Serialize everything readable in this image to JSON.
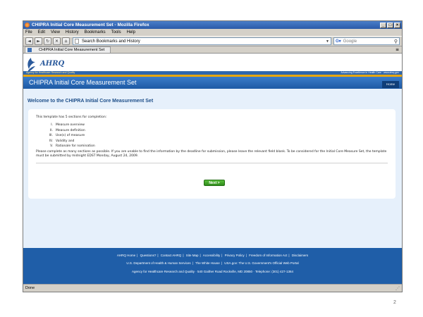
{
  "window": {
    "title": "CHIPRA Initial Core Measurement Set - Mozilla Firefox",
    "min": "_",
    "max": "□",
    "close": "×"
  },
  "menu": [
    "File",
    "Edit",
    "View",
    "History",
    "Bookmarks",
    "Tools",
    "Help"
  ],
  "nav": {
    "back": "◄",
    "forward": "►",
    "reload": "↻",
    "stop": "✕",
    "home": "⌂",
    "url": "Search Bookmarks and History",
    "search_placeholder": "Google"
  },
  "tab": {
    "label": "CHIPRA Initial Core Measurement Set"
  },
  "header": {
    "logo_text": "AHRQ",
    "tagline": "Agency for Healthcare Research and Quality",
    "right_tagline": "Advancing Excellence in Health Care · www.ahrq.gov"
  },
  "page": {
    "title": "CHIPRA Initial Core Measurement Set",
    "home": "Home",
    "welcome": "Welcome to the CHIPRA Initial Core Measurement Set",
    "intro": "This template has 5 sections for completion:",
    "sections": [
      {
        "num": "I.",
        "label": "Measure overview"
      },
      {
        "num": "II.",
        "label": "Measure definition"
      },
      {
        "num": "III.",
        "label": "Use(s) of measure"
      },
      {
        "num": "IV.",
        "label": "Validity and"
      },
      {
        "num": "V.",
        "label": "Rationale for nomination"
      }
    ],
    "note": "Please complete as many sections as possible. If you are unable to find the information by the deadline for submission, please leave the relevant field blank. To be considered for the Initial Core Measure Set, the template must be submitted by midnight EDST Monday, August 24, 2009.",
    "next": "Next >"
  },
  "footer": {
    "row1": [
      "AHRQ Home",
      "Questions?",
      "Contact AHRQ",
      "Site Map",
      "Accessibility",
      "Privacy Policy",
      "Freedom of Information Act",
      "Disclaimers"
    ],
    "row2": [
      "U.S. Department of Health & Human Services",
      "The White House",
      "USA.gov: The U.S. Government's Official Web Portal"
    ],
    "row3": "Agency for Healthcare Research and Quality · 540 Gaither Road Rockville, MD 20850 · Telephone: (301) 427-1364"
  },
  "status": {
    "text": "Done"
  },
  "slide": {
    "number": "2"
  },
  "colors": {
    "brand": "#1f5ea8",
    "accent": "#e8a70f",
    "button": "#2f8a1c"
  }
}
